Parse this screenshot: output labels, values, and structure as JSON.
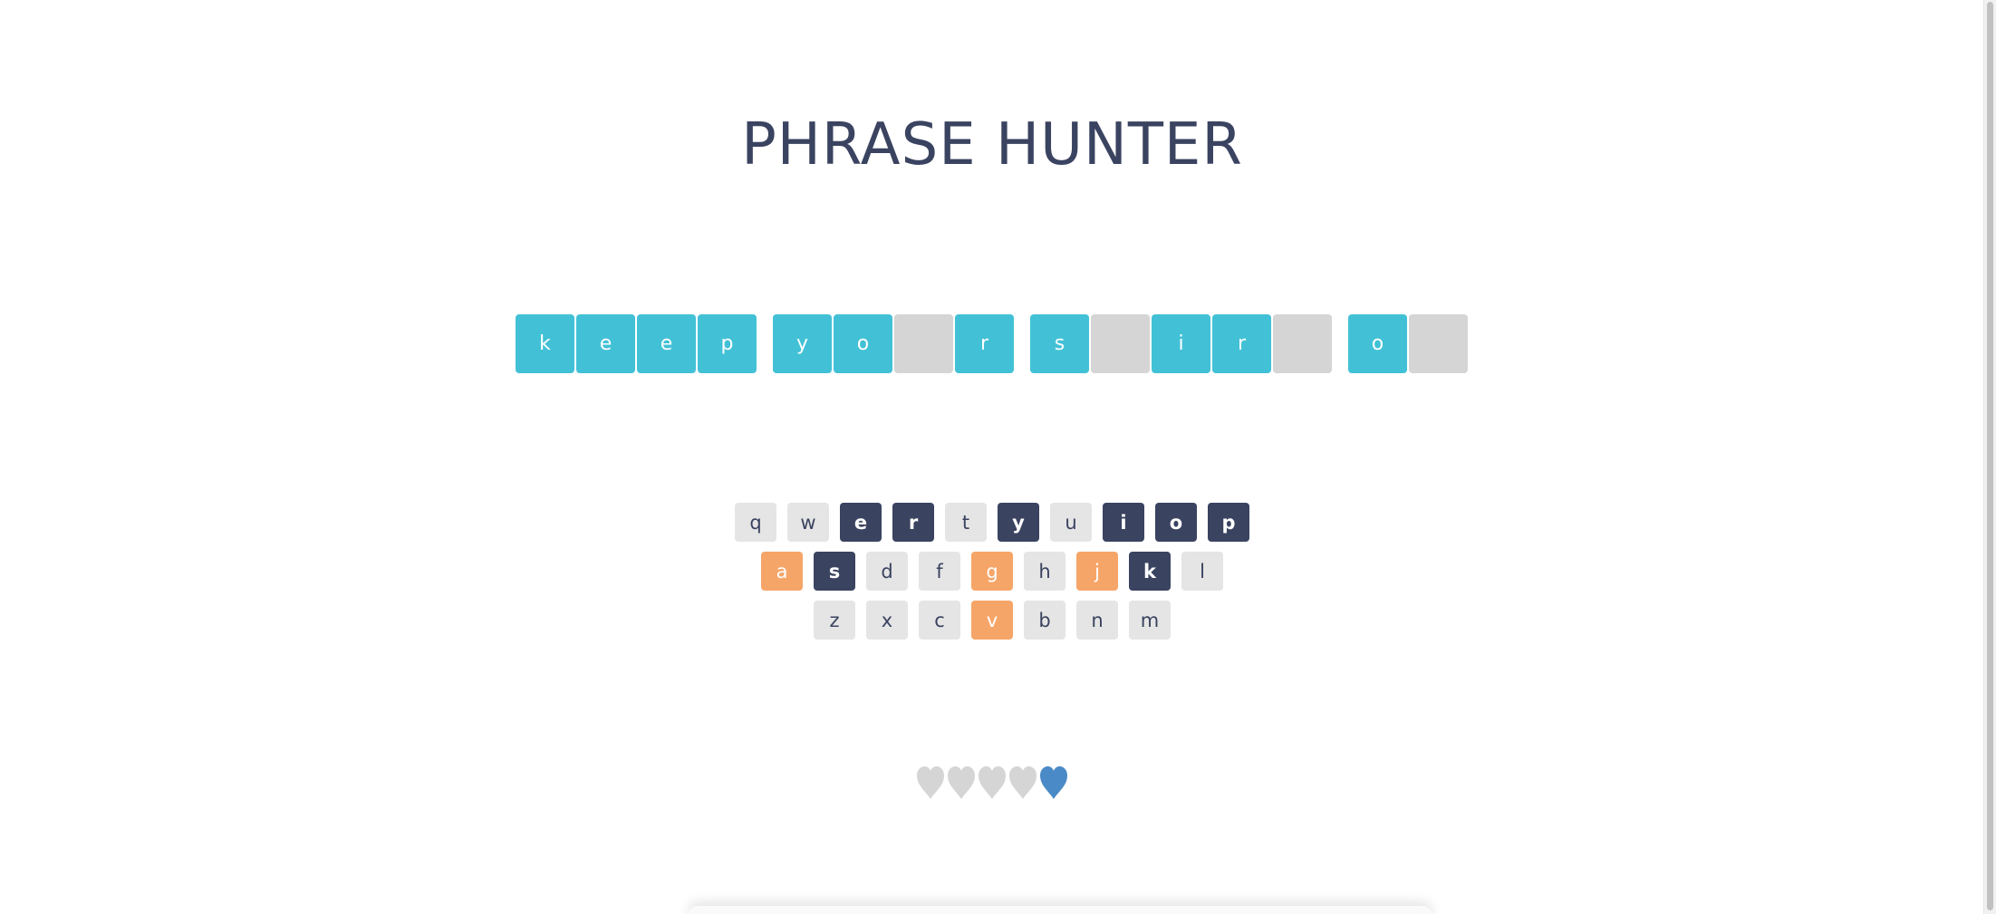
{
  "title": "PHRASE HUNTER",
  "phrase": {
    "words": [
      [
        {
          "letter": "k",
          "shown": true
        },
        {
          "letter": "e",
          "shown": true
        },
        {
          "letter": "e",
          "shown": true
        },
        {
          "letter": "p",
          "shown": true
        }
      ],
      [
        {
          "letter": "y",
          "shown": true
        },
        {
          "letter": "o",
          "shown": true
        },
        {
          "letter": "",
          "shown": false
        },
        {
          "letter": "r",
          "shown": true
        }
      ],
      [
        {
          "letter": "s",
          "shown": true
        },
        {
          "letter": "",
          "shown": false
        },
        {
          "letter": "i",
          "shown": true
        },
        {
          "letter": "r",
          "shown": true
        },
        {
          "letter": "",
          "shown": false
        }
      ],
      [
        {
          "letter": "o",
          "shown": true
        },
        {
          "letter": "",
          "shown": false
        }
      ]
    ]
  },
  "keyboard": {
    "rows": [
      [
        {
          "key": "q",
          "state": "neutral"
        },
        {
          "key": "w",
          "state": "neutral"
        },
        {
          "key": "e",
          "state": "chosen"
        },
        {
          "key": "r",
          "state": "chosen"
        },
        {
          "key": "t",
          "state": "neutral"
        },
        {
          "key": "y",
          "state": "chosen"
        },
        {
          "key": "u",
          "state": "neutral"
        },
        {
          "key": "i",
          "state": "chosen"
        },
        {
          "key": "o",
          "state": "chosen"
        },
        {
          "key": "p",
          "state": "chosen"
        }
      ],
      [
        {
          "key": "a",
          "state": "wrong"
        },
        {
          "key": "s",
          "state": "chosen"
        },
        {
          "key": "d",
          "state": "neutral"
        },
        {
          "key": "f",
          "state": "neutral"
        },
        {
          "key": "g",
          "state": "wrong"
        },
        {
          "key": "h",
          "state": "neutral"
        },
        {
          "key": "j",
          "state": "wrong"
        },
        {
          "key": "k",
          "state": "chosen"
        },
        {
          "key": "l",
          "state": "neutral"
        }
      ],
      [
        {
          "key": "z",
          "state": "neutral"
        },
        {
          "key": "x",
          "state": "neutral"
        },
        {
          "key": "c",
          "state": "neutral"
        },
        {
          "key": "v",
          "state": "wrong"
        },
        {
          "key": "b",
          "state": "neutral"
        },
        {
          "key": "n",
          "state": "neutral"
        },
        {
          "key": "m",
          "state": "neutral"
        }
      ]
    ]
  },
  "lives": {
    "total": 5,
    "remaining": 1,
    "icons": [
      "lost-heart-icon",
      "lost-heart-icon",
      "lost-heart-icon",
      "lost-heart-icon",
      "live-heart-icon"
    ]
  },
  "colors": {
    "title": "#3a4360",
    "revealed_tile": "#42c1d6",
    "hidden_tile": "#d5d5d5",
    "key_neutral": "#e5e5e5",
    "key_chosen": "#3a4360",
    "key_wrong": "#f6a568",
    "heart_live": "#4a8ac6",
    "heart_lost": "#d5d5d5"
  }
}
